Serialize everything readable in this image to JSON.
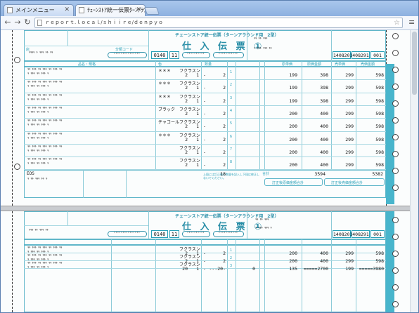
{
  "browser": {
    "tabs": [
      {
        "label": "メインメニュー",
        "active": false
      },
      {
        "label": "ﾁｪｰﾝｽﾄｱ統一伝票ﾀｰﾝｱﾗｳﾝﾄﾞ",
        "active": true
      }
    ],
    "address": "ｒｅｐｏｒｔ.ｌｏｃａｌ/ｓｈｉｉｒｅ/ｄｅｎｐｙｏ"
  },
  "form": {
    "subtitle": "チェーンストア統一伝票（ターンアラウンド用　2型）",
    "title": "仕 入 伝 票 ①",
    "chain_code": "0140",
    "store_code": "11",
    "voucher_no": [
      "1408201",
      "408291",
      "001"
    ],
    "labels": {
      "shop": "店",
      "section": "部門",
      "category": "分類コード",
      "qty": "数量",
      "cost": "原単価",
      "cost_amt": "原価金額",
      "price": "売単価",
      "price_amt": "売価金額",
      "product": "品名・規格",
      "color": "色",
      "size": "サイズ",
      "unit": "単位",
      "total": "合計"
    },
    "rows": [
      {
        "mark": "＊＊＊",
        "size": "フクラスン",
        "u1": "2",
        "u2": "1",
        "qty": "2",
        "cost": "199",
        "costamt": "398",
        "price": "299",
        "priceamt": "598"
      },
      {
        "mark": "＊＊＊",
        "size": "フクラスン",
        "u1": "2",
        "u2": "1",
        "qty": "2",
        "cost": "199",
        "costamt": "398",
        "price": "299",
        "priceamt": "598"
      },
      {
        "mark": "＊＊＊",
        "size": "フクラスン",
        "u1": "2",
        "u2": "1",
        "qty": "2",
        "cost": "199",
        "costamt": "398",
        "price": "299",
        "priceamt": "598"
      },
      {
        "mark": "ブラック",
        "size": "フクラスン",
        "u1": "2",
        "u2": "1",
        "qty": "2",
        "cost": "200",
        "costamt": "400",
        "price": "299",
        "priceamt": "598"
      },
      {
        "mark": "チャコール",
        "size": "フクラスン",
        "u1": "2",
        "u2": "1",
        "qty": "2",
        "cost": "200",
        "costamt": "400",
        "price": "299",
        "priceamt": "598"
      },
      {
        "mark": "＊＊＊",
        "size": "フクラスン",
        "u1": "2",
        "u2": "1",
        "qty": "2",
        "cost": "200",
        "costamt": "400",
        "price": "299",
        "priceamt": "598"
      },
      {
        "mark": "",
        "size": "フクラスン",
        "u1": "2",
        "u2": "1",
        "qty": "2",
        "cost": "200",
        "costamt": "400",
        "price": "299",
        "priceamt": "598"
      },
      {
        "mark": "",
        "size": "フクラスン",
        "u1": "2",
        "u2": "1",
        "qty": "2",
        "cost": "200",
        "costamt": "400",
        "price": "299",
        "priceamt": "598"
      }
    ],
    "totals": {
      "qty": "18",
      "cost": "3594",
      "price": "5382"
    },
    "eos": "EOS",
    "stamp1": "訂正後原価金額合計",
    "stamp2": "訂正後売価金額合計",
    "note": "上段には訂正後の数量を記入し下段は修正しないでください。"
  },
  "form2": {
    "subtitle": "チェーンストア統一伝票（ターンアラウンド用　2型）",
    "title": "仕 入 伝 票 ①",
    "chain_code": "0140",
    "store_code": "11",
    "voucher_no": [
      "1408201",
      "408291",
      "001"
    ],
    "rows": [
      {
        "size": "フクラスン",
        "u1": "2",
        "u2": "1",
        "qty": "2",
        "cost": "200",
        "costamt": "400",
        "price": "299",
        "priceamt": "598"
      },
      {
        "size": "フクラスン",
        "u1": "2",
        "u2": "1",
        "qty": "2",
        "cost": "200",
        "costamt": "400",
        "price": "299",
        "priceamt": "598"
      },
      {
        "size": "フクラスン",
        "u1": "20",
        "u2": "1",
        "qty": "---20-",
        "extra": "0",
        "cost": "135",
        "costamt": "=====2700",
        "price": "199",
        "priceamt": "=====3980"
      }
    ]
  },
  "colors": {
    "accent": "#29a0b8",
    "band": "#48b5cc"
  }
}
